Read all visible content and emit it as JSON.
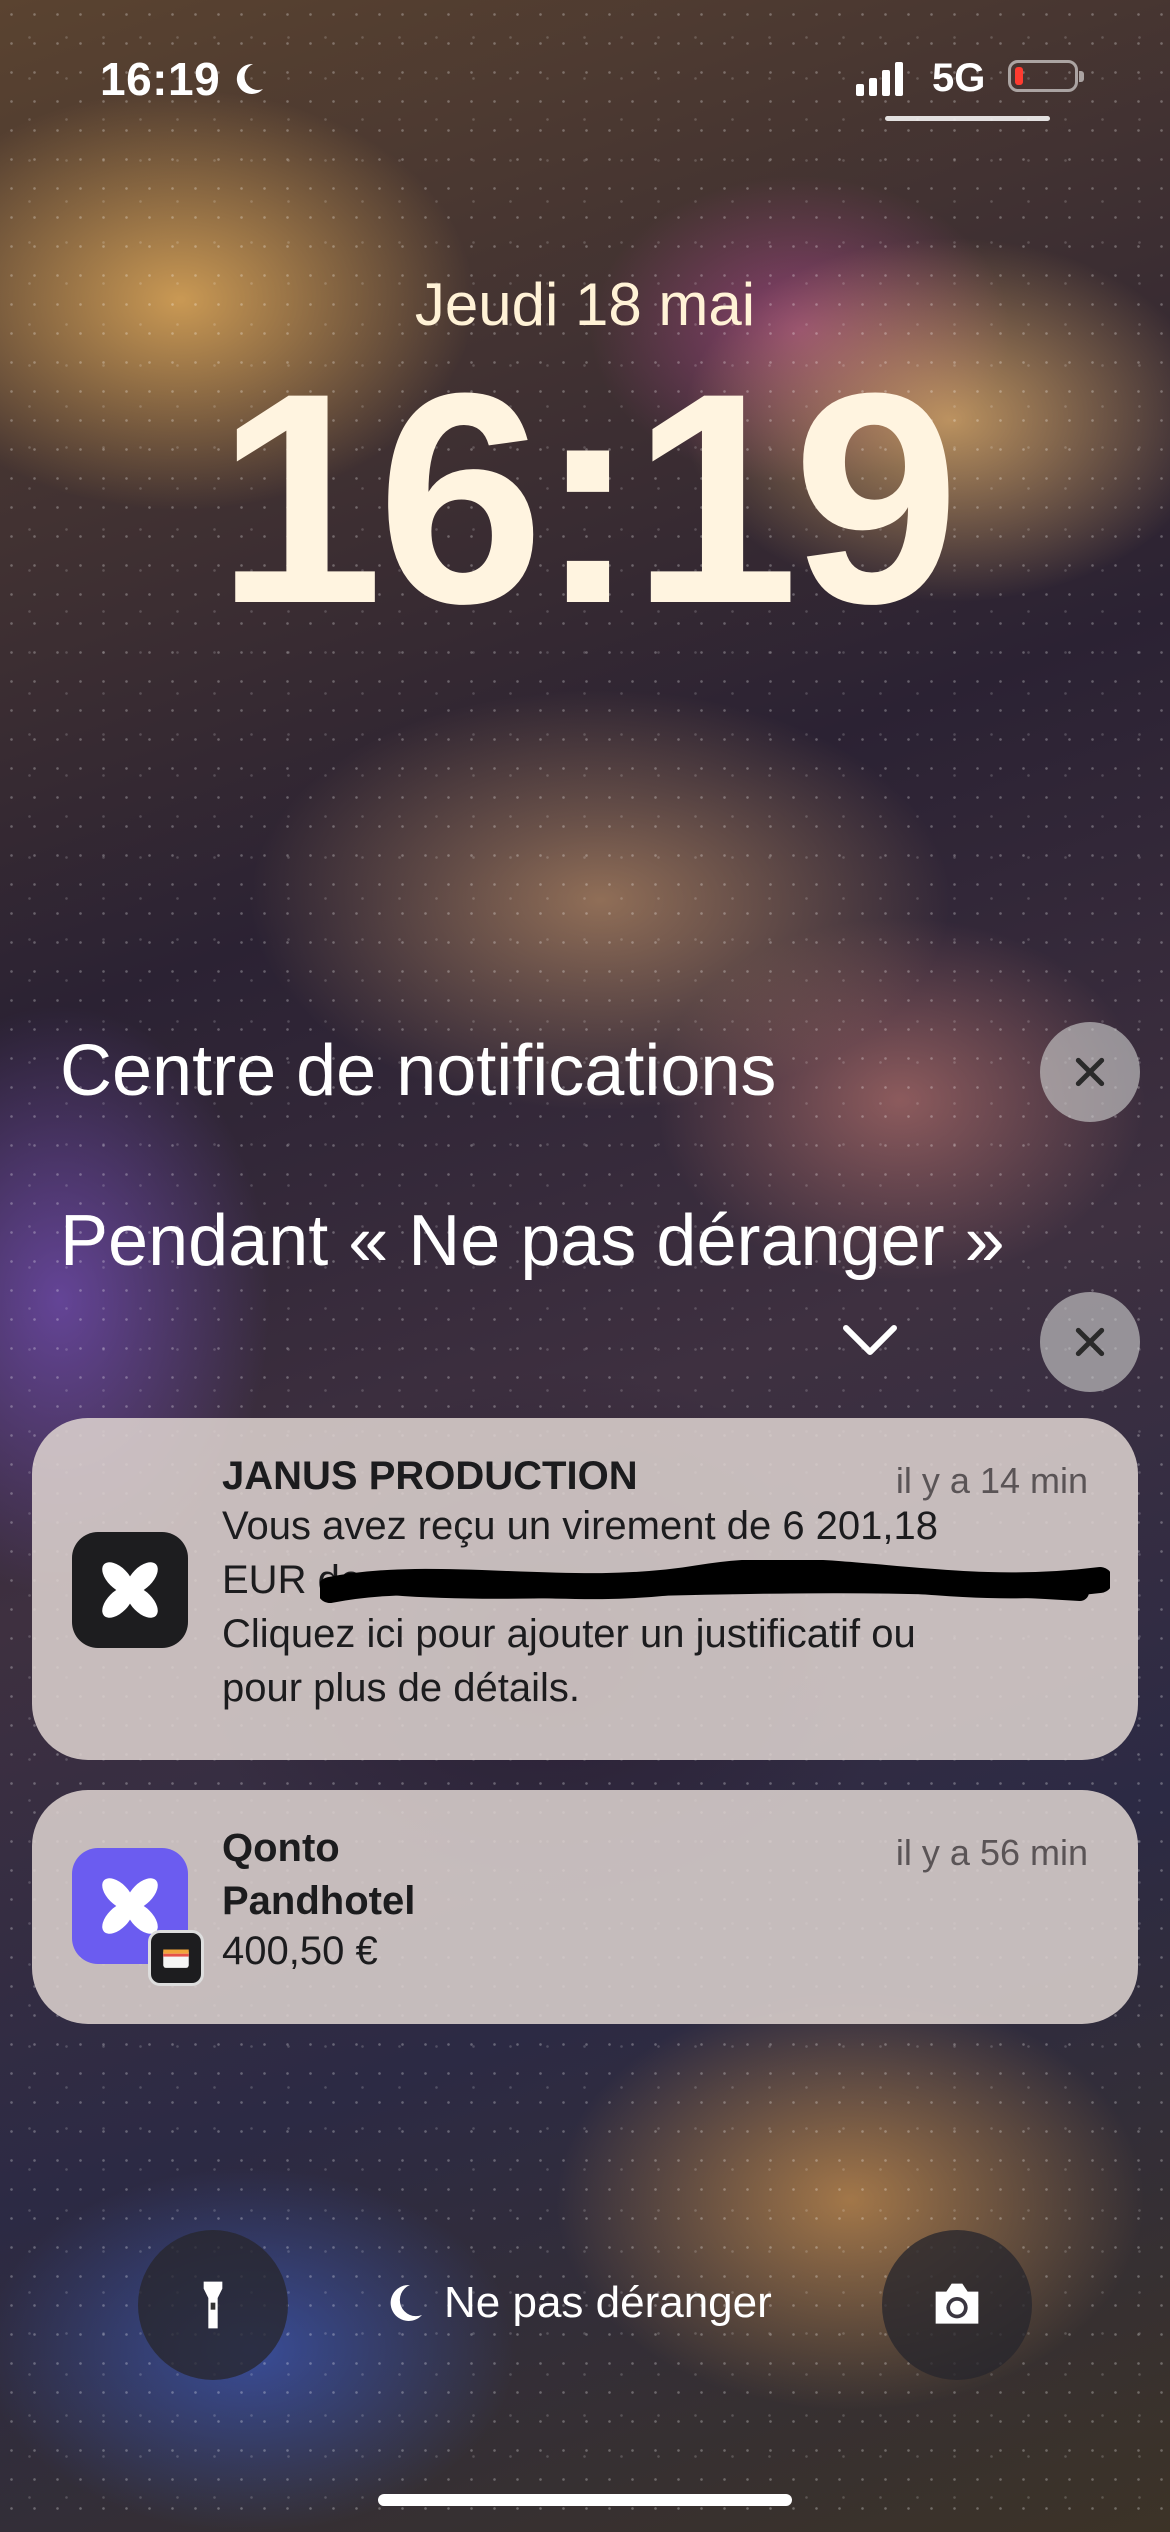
{
  "status_bar": {
    "time": "16:19",
    "network": "5G",
    "battery_color": "#ff3b30",
    "icons": [
      "moon-icon",
      "signal-icon",
      "battery-icon"
    ]
  },
  "lock_screen": {
    "date": "Jeudi 18 mai",
    "time": "16:19"
  },
  "notification_center": {
    "title": "Centre de notifications",
    "dnd_section_title": "Pendant « Ne pas déranger »"
  },
  "notifications": [
    {
      "app": "JANUS PRODUCTION",
      "time": "il y a 14 min",
      "line1": "Vous avez reçu un virement de 6 201,18",
      "line2": "EUR de",
      "line3": "Cliquez ici pour ajouter un justificatif ou",
      "line4": "pour plus de détails.",
      "icon": "qonto-icon",
      "icon_color": "#1d1d1f"
    },
    {
      "app": "Qonto",
      "time": "il y a 56 min",
      "title": "Pandhotel",
      "amount": "400,50 €",
      "icon": "qonto-icon",
      "icon_color": "#6b5cf0",
      "badge_icon": "wallet-icon"
    }
  ],
  "bottom": {
    "focus_label": "Ne pas déranger",
    "left_icon": "flashlight-icon",
    "right_icon": "camera-icon"
  }
}
